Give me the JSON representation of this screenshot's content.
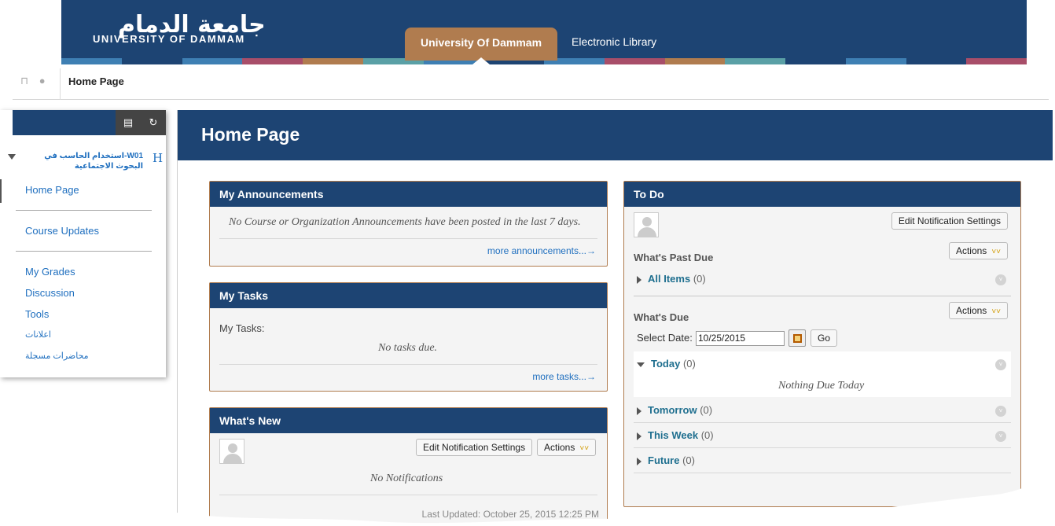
{
  "header": {
    "logo_arabic": "جامعة الدمام",
    "logo_english": "UNIVERSITY OF DAMMAM",
    "tabs": [
      {
        "label": "University Of Dammam",
        "active": true
      },
      {
        "label": "Electronic Library",
        "active": false
      }
    ],
    "stripe_colors": [
      "#3e7fb3",
      "#1d4473",
      "#3e7fb3",
      "#a84e69",
      "#b07c4f",
      "#5aa0a6",
      "#3e7fb3",
      "#1d4473",
      "#3e7fb3",
      "#a84e69",
      "#b07c4f",
      "#5aa0a6",
      "#1d4473",
      "#3e7fb3",
      "#1d4473",
      "#a84e69"
    ]
  },
  "breadcrumb": {
    "current": "Home Page"
  },
  "course_menu": {
    "course_title": "W01-استخدام الحاسب في البحوث الاجتماعية",
    "course_icon": "H",
    "items": [
      {
        "label": "Home Page"
      },
      {
        "label": "Course Updates"
      },
      {
        "label": "My Grades"
      },
      {
        "label": "Discussion"
      },
      {
        "label": "Tools"
      },
      {
        "label": "اعلانات"
      },
      {
        "label": "محاضرات مسجلة"
      }
    ]
  },
  "main": {
    "title": "Home Page",
    "announcements": {
      "title": "My Announcements",
      "message": "No Course or Organization Announcements have been posted in the last 7 days.",
      "more_link": "more announcements...→"
    },
    "tasks": {
      "title": "My Tasks",
      "label": "My Tasks:",
      "message": "No tasks due.",
      "more_link": "more tasks...→"
    },
    "whats_new": {
      "title": "What's New",
      "edit_button": "Edit Notification Settings",
      "actions_button": "Actions",
      "message": "No Notifications",
      "last_updated": "Last Updated: October 25, 2015 12:25 PM"
    },
    "todo": {
      "title": "To Do",
      "edit_button": "Edit Notification Settings",
      "past_due_label": "What's Past Due",
      "actions_button": "Actions",
      "all_items": {
        "label": "All Items",
        "count": "(0)"
      },
      "due_label": "What's Due",
      "select_date_label": "Select Date:",
      "date_value": "10/25/2015",
      "go_button": "Go",
      "today": {
        "label": "Today",
        "count": "(0)",
        "message": "Nothing Due Today"
      },
      "tomorrow": {
        "label": "Tomorrow",
        "count": "(0)"
      },
      "this_week": {
        "label": "This Week",
        "count": "(0)"
      },
      "future": {
        "label": "Future",
        "count": "(0)"
      }
    }
  }
}
